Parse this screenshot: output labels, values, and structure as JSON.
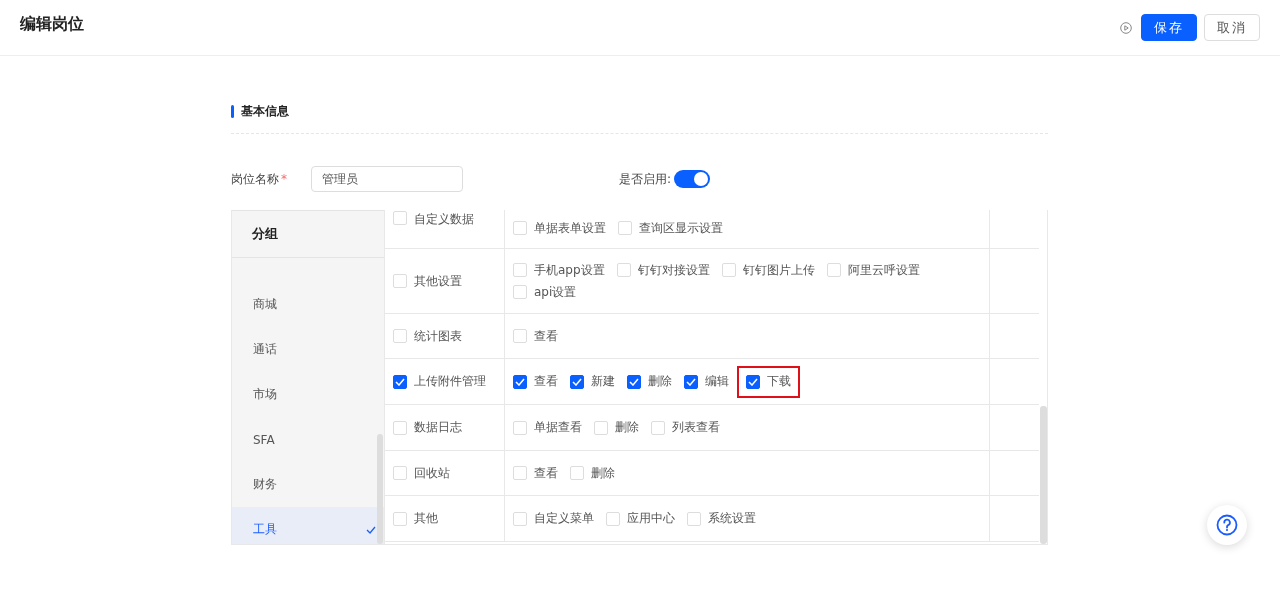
{
  "header": {
    "title": "编辑岗位",
    "buttons": [
      {
        "label": "保存",
        "kind": "primary"
      },
      {
        "label": "取消",
        "kind": "default"
      }
    ]
  },
  "section": {
    "title": "基本信息"
  },
  "form": {
    "name_label": "岗位名称",
    "required_mark": "*",
    "name_value": "管理员",
    "enable_label": "是否启用:",
    "enabled": true
  },
  "groups": {
    "header": "分组",
    "items": [
      {
        "label": "商城",
        "selected": false
      },
      {
        "label": "通话",
        "selected": false
      },
      {
        "label": "市场",
        "selected": false
      },
      {
        "label": "SFA",
        "selected": false
      },
      {
        "label": "财务",
        "selected": false
      },
      {
        "label": "工具",
        "selected": true
      }
    ]
  },
  "permissions": [
    {
      "module": "自定义数据",
      "checked": false,
      "options": [
        {
          "label": "单据表单设置",
          "checked": false,
          "highlighted": false
        },
        {
          "label": "查询区显示设置",
          "checked": false,
          "highlighted": false
        }
      ]
    },
    {
      "module": "其他设置",
      "checked": false,
      "options": [
        {
          "label": "手机app设置",
          "checked": false,
          "highlighted": false
        },
        {
          "label": "钉钉对接设置",
          "checked": false,
          "highlighted": false
        },
        {
          "label": "钉钉图片上传",
          "checked": false,
          "highlighted": false
        },
        {
          "label": "阿里云呼设置",
          "checked": false,
          "highlighted": false
        },
        {
          "label": "api设置",
          "checked": false,
          "highlighted": false
        }
      ]
    },
    {
      "module": "统计图表",
      "checked": false,
      "options": [
        {
          "label": "查看",
          "checked": false,
          "highlighted": false
        }
      ]
    },
    {
      "module": "上传附件管理",
      "checked": true,
      "options": [
        {
          "label": "查看",
          "checked": true,
          "highlighted": false
        },
        {
          "label": "新建",
          "checked": true,
          "highlighted": false
        },
        {
          "label": "删除",
          "checked": true,
          "highlighted": false
        },
        {
          "label": "编辑",
          "checked": true,
          "highlighted": false
        },
        {
          "label": "下载",
          "checked": true,
          "highlighted": true
        }
      ]
    },
    {
      "module": "数据日志",
      "checked": false,
      "options": [
        {
          "label": "单据查看",
          "checked": false,
          "highlighted": false
        },
        {
          "label": "删除",
          "checked": false,
          "highlighted": false
        },
        {
          "label": "列表查看",
          "checked": false,
          "highlighted": false
        }
      ]
    },
    {
      "module": "回收站",
      "checked": false,
      "options": [
        {
          "label": "查看",
          "checked": false,
          "highlighted": false
        },
        {
          "label": "删除",
          "checked": false,
          "highlighted": false
        }
      ]
    },
    {
      "module": "其他",
      "checked": false,
      "options": [
        {
          "label": "自定义菜单",
          "checked": false,
          "highlighted": false
        },
        {
          "label": "应用中心",
          "checked": false,
          "highlighted": false
        },
        {
          "label": "系统设置",
          "checked": false,
          "highlighted": false
        }
      ]
    }
  ]
}
